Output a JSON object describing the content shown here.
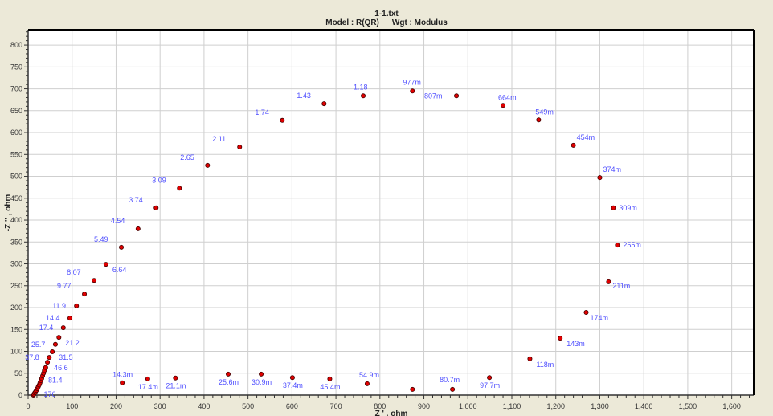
{
  "chart_data": {
    "type": "scatter",
    "title": "1-1.txt",
    "subtitle_model": "Model : R(QR)",
    "subtitle_weight": "Wgt : Modulus",
    "xlabel": "Z ' , ohm",
    "ylabel": "-Z '' , ohm",
    "xlim": [
      0,
      1650
    ],
    "ylim": [
      0,
      835
    ],
    "grid": true,
    "x_ticks": [
      0,
      100,
      200,
      300,
      400,
      500,
      600,
      700,
      800,
      900,
      1000,
      1100,
      1200,
      1300,
      1400,
      1500,
      1600
    ],
    "x_tick_labels": [
      "0",
      "100",
      "200",
      "300",
      "400",
      "500",
      "600",
      "700",
      "800",
      "900",
      "1,000",
      "1,100",
      "1,200",
      "1,300",
      "1,400",
      "1,500",
      "1,600"
    ],
    "y_ticks": [
      0,
      50,
      100,
      150,
      200,
      250,
      300,
      350,
      400,
      450,
      500,
      550,
      600,
      650,
      700,
      750,
      800
    ],
    "y_tick_labels": [
      "0",
      "50",
      "100",
      "150",
      "200",
      "250",
      "300",
      "350",
      "400",
      "450",
      "500",
      "550",
      "600",
      "650",
      "700",
      "750",
      "800"
    ],
    "points": [
      {
        "x": 12,
        "y": 0,
        "label": ""
      },
      {
        "x": 13,
        "y": 2,
        "label": ""
      },
      {
        "x": 15,
        "y": 5,
        "label": ""
      },
      {
        "x": 17,
        "y": 8,
        "label": ""
      },
      {
        "x": 19,
        "y": 11,
        "label": ""
      },
      {
        "x": 21,
        "y": 15,
        "label": "176"
      },
      {
        "x": 23,
        "y": 19,
        "label": ""
      },
      {
        "x": 25,
        "y": 23,
        "label": ""
      },
      {
        "x": 27,
        "y": 28,
        "label": ""
      },
      {
        "x": 29,
        "y": 33,
        "label": ""
      },
      {
        "x": 31,
        "y": 38,
        "label": "81.4"
      },
      {
        "x": 33,
        "y": 44,
        "label": ""
      },
      {
        "x": 35,
        "y": 50,
        "label": ""
      },
      {
        "x": 37,
        "y": 56,
        "label": ""
      },
      {
        "x": 40,
        "y": 63,
        "label": ""
      },
      {
        "x": 44,
        "y": 75,
        "label": "46.6"
      },
      {
        "x": 48,
        "y": 86,
        "label": "37.8"
      },
      {
        "x": 55,
        "y": 99,
        "label": "31.5"
      },
      {
        "x": 62,
        "y": 116,
        "label": "25.7"
      },
      {
        "x": 70,
        "y": 132,
        "label": "21.2"
      },
      {
        "x": 80,
        "y": 154,
        "label": "17.4"
      },
      {
        "x": 95,
        "y": 176,
        "label": "14.4"
      },
      {
        "x": 110,
        "y": 204,
        "label": "11.9"
      },
      {
        "x": 128,
        "y": 231,
        "label": "9.77"
      },
      {
        "x": 150,
        "y": 262,
        "label": "8.07"
      },
      {
        "x": 177,
        "y": 299,
        "label": "6.64"
      },
      {
        "x": 212,
        "y": 338,
        "label": "5.49"
      },
      {
        "x": 250,
        "y": 380,
        "label": "4.54"
      },
      {
        "x": 291,
        "y": 428,
        "label": "3.74"
      },
      {
        "x": 344,
        "y": 473,
        "label": "3.09"
      },
      {
        "x": 408,
        "y": 525,
        "label": "2.65"
      },
      {
        "x": 481,
        "y": 567,
        "label": "2.11"
      },
      {
        "x": 578,
        "y": 628,
        "label": "1.74"
      },
      {
        "x": 673,
        "y": 666,
        "label": "1.43"
      },
      {
        "x": 762,
        "y": 684,
        "label": "1.18"
      },
      {
        "x": 874,
        "y": 695,
        "label": "977m"
      },
      {
        "x": 974,
        "y": 684,
        "label": "807m"
      },
      {
        "x": 1080,
        "y": 662,
        "label": "664m"
      },
      {
        "x": 1161,
        "y": 629,
        "label": "549m"
      },
      {
        "x": 1240,
        "y": 571,
        "label": "454m"
      },
      {
        "x": 1300,
        "y": 497,
        "label": "374m"
      },
      {
        "x": 1331,
        "y": 428,
        "label": "309m"
      },
      {
        "x": 1340,
        "y": 343,
        "label": "255m"
      },
      {
        "x": 1320,
        "y": 259,
        "label": "211m"
      },
      {
        "x": 1269,
        "y": 189,
        "label": "174m"
      },
      {
        "x": 1210,
        "y": 130,
        "label": "143m"
      },
      {
        "x": 1141,
        "y": 83,
        "label": "118m"
      },
      {
        "x": 1049,
        "y": 40,
        "label": "97.7m"
      },
      {
        "x": 965,
        "y": 13,
        "label": "80.7m"
      },
      {
        "x": 874,
        "y": 13,
        "label": ""
      },
      {
        "x": 771,
        "y": 26,
        "label": "54.9m"
      },
      {
        "x": 686,
        "y": 37,
        "label": "45.4m"
      },
      {
        "x": 601,
        "y": 40,
        "label": "37.4m"
      },
      {
        "x": 530,
        "y": 48,
        "label": "30.9m"
      },
      {
        "x": 455,
        "y": 48,
        "label": "25.6m"
      },
      {
        "x": 335,
        "y": 39,
        "label": "21.1m"
      },
      {
        "x": 272,
        "y": 37,
        "label": "17.4m"
      },
      {
        "x": 214,
        "y": 28,
        "label": "14.3m"
      }
    ],
    "colors": {
      "point": "#e00000",
      "label": "#5050ff",
      "grid": "#cfcfcf",
      "background": "#ECE9D8"
    }
  }
}
